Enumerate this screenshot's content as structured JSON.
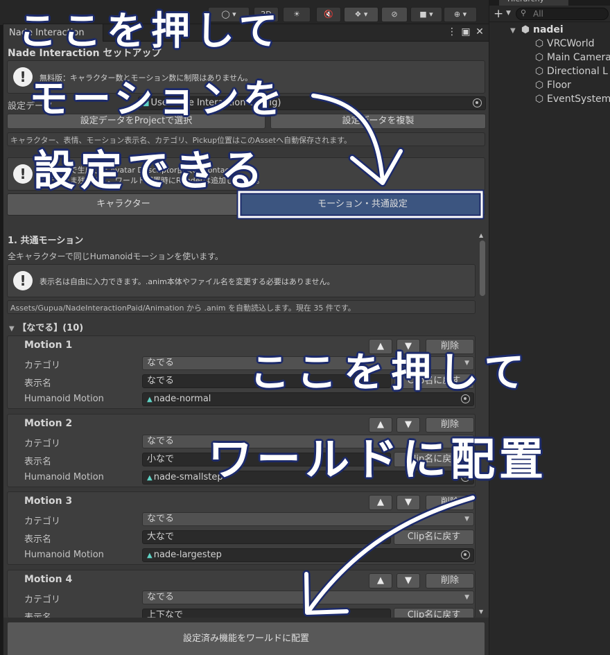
{
  "scene_toolbar": {
    "mode_2d": "2D"
  },
  "hierarchy": {
    "tab": "Hierarchy",
    "search_placeholder": "All",
    "root": "nadei",
    "items": [
      "VRCWorld",
      "Main Camera",
      "Directional L",
      "Floor",
      "EventSystem"
    ]
  },
  "window": {
    "tab": "Nade Interaction",
    "title": "Nade Interaction セットアップ",
    "notice1": "無料版：キャラクター数とモーション数に制限はありません。",
    "config_label": "設定データ",
    "config_value": "Use Nade Interaction Config)",
    "select_button": "設定データをProjectで選択",
    "duplicate_button": "設定データを複製",
    "autosave_info": "キャラクター、表情、モーション表示名、カテゴリ、Pickup位置はこのAssetへ自動保存されます。",
    "notice2_line1": "書き出しで生成した Avatar Descriptor由来の Contact",
    "notice2_line2": "はそのまま残ります。ワールド配置時にRenderは追加しません。",
    "tab_character": "キャラクター",
    "tab_motion": "モーション・共通設定",
    "section_title": "1. 共通モーション",
    "section_desc": "全キャラクターで同じHumanoidモーションを使います。",
    "notice3": "表示名は自由に入力できます。.anim本体やファイル名を変更する必要はありません。",
    "path_info": "Assets/Gupua/NadeInteractionPaid/Animation から .anim を自動読込します。現在 35 件です。",
    "group_label": "【なでる】(10)",
    "category_label": "カテゴリ",
    "display_name_label": "表示名",
    "humanoid_label": "Humanoid Motion",
    "up_arrow": "▲",
    "down_arrow": "▼",
    "delete_label": "削除",
    "reset_label": "Clip名に戻す",
    "place_button": "設定済み機能をワールドに配置"
  },
  "motions": [
    {
      "title": "Motion 1",
      "category": "なでる",
      "display_name": "なでる",
      "clip": "nade-normal"
    },
    {
      "title": "Motion 2",
      "category": "なでる",
      "display_name": "小なで",
      "clip": "nade-smallstep"
    },
    {
      "title": "Motion 3",
      "category": "なでる",
      "display_name": "大なで",
      "clip": "nade-largestep"
    },
    {
      "title": "Motion 4",
      "category": "なでる",
      "display_name": "上下なで",
      "clip": ""
    }
  ],
  "annotations": {
    "line1": "ここを押して",
    "line2": "モーションを",
    "line3": "設定できる",
    "line4": "ここを押して",
    "line5": "ワールドに配置"
  },
  "colors": {
    "highlight_border": "#ffffff",
    "highlight_outline": "#1c2a6a",
    "active_tab": "#3c5580",
    "annotation_text": "#ffffff",
    "annotation_outline": "#1c2a6a"
  }
}
